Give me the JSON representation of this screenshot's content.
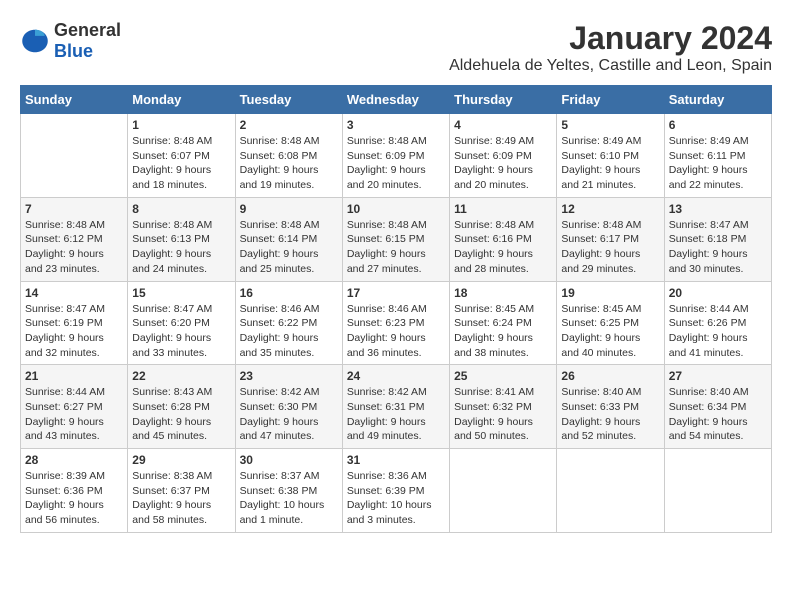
{
  "logo": {
    "general": "General",
    "blue": "Blue"
  },
  "header": {
    "month": "January 2024",
    "location": "Aldehuela de Yeltes, Castille and Leon, Spain"
  },
  "days_of_week": [
    "Sunday",
    "Monday",
    "Tuesday",
    "Wednesday",
    "Thursday",
    "Friday",
    "Saturday"
  ],
  "weeks": [
    [
      {
        "date": "",
        "sunrise": "",
        "sunset": "",
        "daylight": ""
      },
      {
        "date": "1",
        "sunrise": "Sunrise: 8:48 AM",
        "sunset": "Sunset: 6:07 PM",
        "daylight": "Daylight: 9 hours and 18 minutes."
      },
      {
        "date": "2",
        "sunrise": "Sunrise: 8:48 AM",
        "sunset": "Sunset: 6:08 PM",
        "daylight": "Daylight: 9 hours and 19 minutes."
      },
      {
        "date": "3",
        "sunrise": "Sunrise: 8:48 AM",
        "sunset": "Sunset: 6:09 PM",
        "daylight": "Daylight: 9 hours and 20 minutes."
      },
      {
        "date": "4",
        "sunrise": "Sunrise: 8:49 AM",
        "sunset": "Sunset: 6:09 PM",
        "daylight": "Daylight: 9 hours and 20 minutes."
      },
      {
        "date": "5",
        "sunrise": "Sunrise: 8:49 AM",
        "sunset": "Sunset: 6:10 PM",
        "daylight": "Daylight: 9 hours and 21 minutes."
      },
      {
        "date": "6",
        "sunrise": "Sunrise: 8:49 AM",
        "sunset": "Sunset: 6:11 PM",
        "daylight": "Daylight: 9 hours and 22 minutes."
      }
    ],
    [
      {
        "date": "7",
        "sunrise": "Sunrise: 8:48 AM",
        "sunset": "Sunset: 6:12 PM",
        "daylight": "Daylight: 9 hours and 23 minutes."
      },
      {
        "date": "8",
        "sunrise": "Sunrise: 8:48 AM",
        "sunset": "Sunset: 6:13 PM",
        "daylight": "Daylight: 9 hours and 24 minutes."
      },
      {
        "date": "9",
        "sunrise": "Sunrise: 8:48 AM",
        "sunset": "Sunset: 6:14 PM",
        "daylight": "Daylight: 9 hours and 25 minutes."
      },
      {
        "date": "10",
        "sunrise": "Sunrise: 8:48 AM",
        "sunset": "Sunset: 6:15 PM",
        "daylight": "Daylight: 9 hours and 27 minutes."
      },
      {
        "date": "11",
        "sunrise": "Sunrise: 8:48 AM",
        "sunset": "Sunset: 6:16 PM",
        "daylight": "Daylight: 9 hours and 28 minutes."
      },
      {
        "date": "12",
        "sunrise": "Sunrise: 8:48 AM",
        "sunset": "Sunset: 6:17 PM",
        "daylight": "Daylight: 9 hours and 29 minutes."
      },
      {
        "date": "13",
        "sunrise": "Sunrise: 8:47 AM",
        "sunset": "Sunset: 6:18 PM",
        "daylight": "Daylight: 9 hours and 30 minutes."
      }
    ],
    [
      {
        "date": "14",
        "sunrise": "Sunrise: 8:47 AM",
        "sunset": "Sunset: 6:19 PM",
        "daylight": "Daylight: 9 hours and 32 minutes."
      },
      {
        "date": "15",
        "sunrise": "Sunrise: 8:47 AM",
        "sunset": "Sunset: 6:20 PM",
        "daylight": "Daylight: 9 hours and 33 minutes."
      },
      {
        "date": "16",
        "sunrise": "Sunrise: 8:46 AM",
        "sunset": "Sunset: 6:22 PM",
        "daylight": "Daylight: 9 hours and 35 minutes."
      },
      {
        "date": "17",
        "sunrise": "Sunrise: 8:46 AM",
        "sunset": "Sunset: 6:23 PM",
        "daylight": "Daylight: 9 hours and 36 minutes."
      },
      {
        "date": "18",
        "sunrise": "Sunrise: 8:45 AM",
        "sunset": "Sunset: 6:24 PM",
        "daylight": "Daylight: 9 hours and 38 minutes."
      },
      {
        "date": "19",
        "sunrise": "Sunrise: 8:45 AM",
        "sunset": "Sunset: 6:25 PM",
        "daylight": "Daylight: 9 hours and 40 minutes."
      },
      {
        "date": "20",
        "sunrise": "Sunrise: 8:44 AM",
        "sunset": "Sunset: 6:26 PM",
        "daylight": "Daylight: 9 hours and 41 minutes."
      }
    ],
    [
      {
        "date": "21",
        "sunrise": "Sunrise: 8:44 AM",
        "sunset": "Sunset: 6:27 PM",
        "daylight": "Daylight: 9 hours and 43 minutes."
      },
      {
        "date": "22",
        "sunrise": "Sunrise: 8:43 AM",
        "sunset": "Sunset: 6:28 PM",
        "daylight": "Daylight: 9 hours and 45 minutes."
      },
      {
        "date": "23",
        "sunrise": "Sunrise: 8:42 AM",
        "sunset": "Sunset: 6:30 PM",
        "daylight": "Daylight: 9 hours and 47 minutes."
      },
      {
        "date": "24",
        "sunrise": "Sunrise: 8:42 AM",
        "sunset": "Sunset: 6:31 PM",
        "daylight": "Daylight: 9 hours and 49 minutes."
      },
      {
        "date": "25",
        "sunrise": "Sunrise: 8:41 AM",
        "sunset": "Sunset: 6:32 PM",
        "daylight": "Daylight: 9 hours and 50 minutes."
      },
      {
        "date": "26",
        "sunrise": "Sunrise: 8:40 AM",
        "sunset": "Sunset: 6:33 PM",
        "daylight": "Daylight: 9 hours and 52 minutes."
      },
      {
        "date": "27",
        "sunrise": "Sunrise: 8:40 AM",
        "sunset": "Sunset: 6:34 PM",
        "daylight": "Daylight: 9 hours and 54 minutes."
      }
    ],
    [
      {
        "date": "28",
        "sunrise": "Sunrise: 8:39 AM",
        "sunset": "Sunset: 6:36 PM",
        "daylight": "Daylight: 9 hours and 56 minutes."
      },
      {
        "date": "29",
        "sunrise": "Sunrise: 8:38 AM",
        "sunset": "Sunset: 6:37 PM",
        "daylight": "Daylight: 9 hours and 58 minutes."
      },
      {
        "date": "30",
        "sunrise": "Sunrise: 8:37 AM",
        "sunset": "Sunset: 6:38 PM",
        "daylight": "Daylight: 10 hours and 1 minute."
      },
      {
        "date": "31",
        "sunrise": "Sunrise: 8:36 AM",
        "sunset": "Sunset: 6:39 PM",
        "daylight": "Daylight: 10 hours and 3 minutes."
      },
      {
        "date": "",
        "sunrise": "",
        "sunset": "",
        "daylight": ""
      },
      {
        "date": "",
        "sunrise": "",
        "sunset": "",
        "daylight": ""
      },
      {
        "date": "",
        "sunrise": "",
        "sunset": "",
        "daylight": ""
      }
    ]
  ]
}
